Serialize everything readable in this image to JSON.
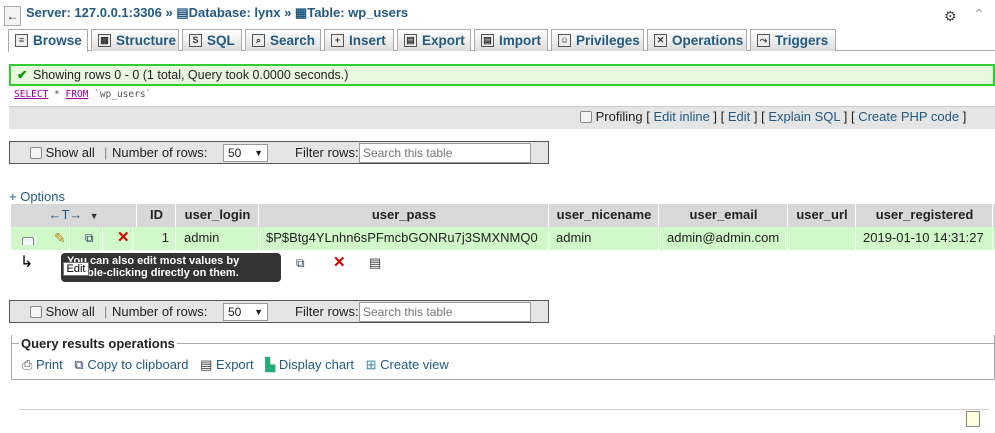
{
  "breadcrumb": {
    "server": "Server: 127.0.0.1:3306",
    "database": "Database: lynx",
    "table": "Table: wp_users",
    "sep": "»"
  },
  "tabs": [
    {
      "label": "Browse",
      "icon": "browse-icon"
    },
    {
      "label": "Structure",
      "icon": "structure-icon"
    },
    {
      "label": "SQL",
      "icon": "sql-icon"
    },
    {
      "label": "Search",
      "icon": "search-icon"
    },
    {
      "label": "Insert",
      "icon": "insert-icon"
    },
    {
      "label": "Export",
      "icon": "export-icon"
    },
    {
      "label": "Import",
      "icon": "import-icon"
    },
    {
      "label": "Privileges",
      "icon": "privileges-icon"
    },
    {
      "label": "Operations",
      "icon": "operations-icon"
    },
    {
      "label": "Triggers",
      "icon": "triggers-icon"
    }
  ],
  "message": "Showing rows 0 - 0 (1 total, Query took 0.0000 seconds.)",
  "sql": {
    "keyword_select": "SELECT",
    "keyword_from": "FROM",
    "rest": " * ",
    "table": " `wp_users`"
  },
  "profiling": {
    "label": "Profiling",
    "edit_inline": "Edit inline",
    "edit": "Edit",
    "explain": "Explain SQL",
    "php": "Create PHP code"
  },
  "nav": {
    "show_all": "Show all",
    "num_rows_label": "Number of rows:",
    "num_rows_value": "50",
    "filter_label": "Filter rows:",
    "filter_placeholder": "Search this table"
  },
  "options_link": "+ Options",
  "columns": [
    "ID",
    "user_login",
    "user_pass",
    "user_nicename",
    "user_email",
    "user_url",
    "user_registered"
  ],
  "row": {
    "ID": "1",
    "user_login": "admin",
    "user_pass": "$P$Btg4YLnhn6sPFmcbGONRu7j3SMXNMQ0",
    "user_nicename": "admin",
    "user_email": "admin@admin.com",
    "user_url": "",
    "user_registered": "2019-01-10 14:31:27"
  },
  "tooltip": {
    "text": "You can also edit most values by double-clicking directly on them.",
    "edit_label": "Edit"
  },
  "query_ops": {
    "legend": "Query results operations",
    "print": "Print",
    "copy": "Copy to clipboard",
    "export": "Export",
    "chart": "Display chart",
    "view": "Create view"
  },
  "colors": {
    "accent": "#235a81",
    "success_border": "#33cc33",
    "row_highlight": "#d0f8c8"
  }
}
